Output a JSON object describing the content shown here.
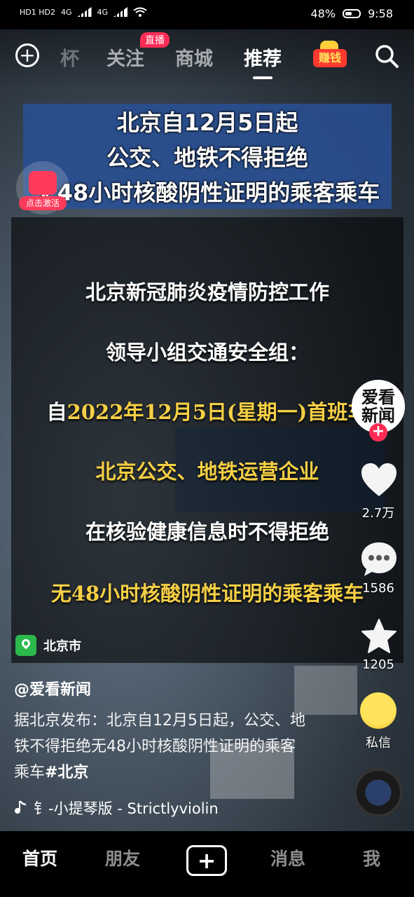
{
  "status_bar": {
    "sim": "HD1 HD2",
    "network1": "4G",
    "network2": "4G",
    "battery": "48%",
    "time": "9:58"
  },
  "top_nav": {
    "tabs": [
      {
        "label": "杯"
      },
      {
        "label": "关注"
      },
      {
        "label": "商城"
      },
      {
        "label": "推荐"
      }
    ],
    "live_badge": "直播",
    "earn_label": "赚钱"
  },
  "video": {
    "headline_lines": [
      "北京自12月5日起",
      "公交、地铁不得拒绝",
      "无48小时核酸阴性证明的乘客乘车"
    ],
    "activate_tag": "点击激活",
    "panel_lines": [
      {
        "text": "北京新冠肺炎疫情防控工作",
        "color": "white"
      },
      {
        "text": "领导小组交通安全组：",
        "color": "white"
      },
      {
        "text": "自2022年12月5日(星期一)首班车",
        "color": "mixed"
      },
      {
        "text": "北京公交、地铁运营企业",
        "color": "yellow"
      },
      {
        "text": "在核验健康信息时不得拒绝",
        "color": "white"
      },
      {
        "text": "无48小时核酸阴性证明的乘客乘车",
        "color": "yellow"
      }
    ],
    "panel_line3_prefix": "自",
    "panel_line3_rest": "2022年12月5日(星期一)首班车",
    "location": "北京市"
  },
  "side_bar": {
    "avatar_text_1": "爱看",
    "avatar_text_2": "新闻",
    "likes": "2.7万",
    "comments": "1586",
    "favorites": "1205",
    "dm_label": "私信"
  },
  "post": {
    "author": "@爱看新闻",
    "description": "据北京发布：北京自12月5日起，公交、地铁不得拒绝无48小时核酸阴性证明的乘客乘车",
    "hashtag": "#北京",
    "music": "钅-小提琴版 - Strictlyviolin"
  },
  "bottom_nav": {
    "home": "首页",
    "friends": "朋友",
    "messages": "消息",
    "me": "我"
  }
}
